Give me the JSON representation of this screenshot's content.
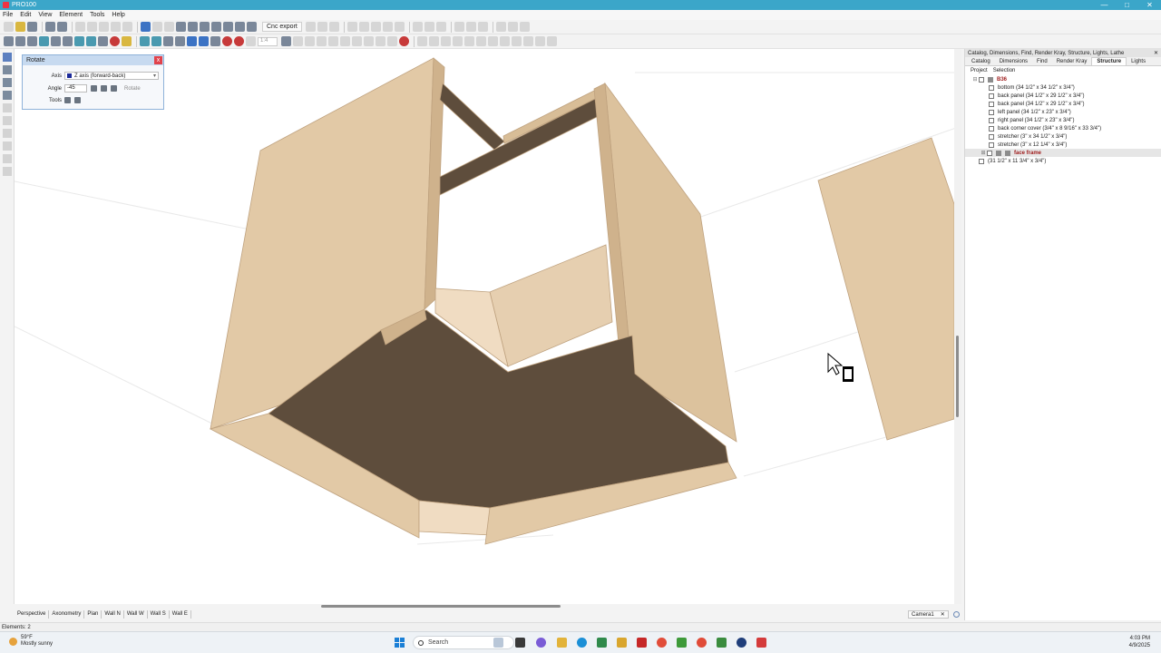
{
  "window": {
    "title": "PRO100",
    "controls": [
      "—",
      "□",
      "✕"
    ]
  },
  "menu": [
    "File",
    "Edit",
    "View",
    "Element",
    "Tools",
    "Help"
  ],
  "toolbar": {
    "cnc_export": "Cnc export",
    "zoom_value": "1:4"
  },
  "rotate_dialog": {
    "title": "Rotate",
    "axis_label": "Axis",
    "axis_value": "Z axis (forward-back)",
    "angle_label": "Angle",
    "angle_value": "-45",
    "tools_label": "Tools",
    "rotate_button": "Rotate",
    "close": "x"
  },
  "right_panel": {
    "title": "Catalog, Dimensions, Find, Render Kray, Structure, Lights, Lathe",
    "tabs": [
      "Catalog",
      "Dimensions",
      "Find",
      "Render Kray",
      "Structure",
      "Lights"
    ],
    "active_tab": "Structure",
    "subtabs": [
      "Project",
      "Selection"
    ],
    "tree": {
      "root": "B36",
      "items": [
        "bottom  (34 1/2\" x 34 1/2\" x 3/4\")",
        "back panel  (34 1/2\" x 29 1/2\" x 3/4\")",
        "back panel  (34 1/2\" x 29 1/2\" x 3/4\")",
        "left panel  (34 1/2\" x 23\" x 3/4\")",
        "right panel  (34 1/2\" x 23\" x 3/4\")",
        "back corner cover  (3/4\" x 8 9/16\" x 33 3/4\")",
        "stretcher  (3\" x 34 1/2\" x 3/4\")",
        "stretcher  (3\" x 12 1/4\" x 3/4\")"
      ],
      "group": "face frame",
      "loose_item": "(31 1/2\" x 11 3/4\" x 3/4\")"
    }
  },
  "view_tabs": [
    "Perspective",
    "Axonometry",
    "Plan",
    "Wall N",
    "Wall W",
    "Wall S",
    "Wall E"
  ],
  "camera_tab": {
    "label": "Camera1",
    "close": "✕"
  },
  "status": {
    "elements": "Elements: 2"
  },
  "taskbar": {
    "weather_temp": "59°F",
    "weather_desc": "Mostly sunny",
    "search": "Search",
    "time": "4:03 PM",
    "date": "4/9/2025"
  },
  "colors": {
    "titlebar": "#3ba6c9",
    "wood_light": "#e2c9a6",
    "wood_mid": "#d8bd97",
    "wood_dark": "#5e4d3c",
    "tree_root": "#9e1b1b"
  }
}
